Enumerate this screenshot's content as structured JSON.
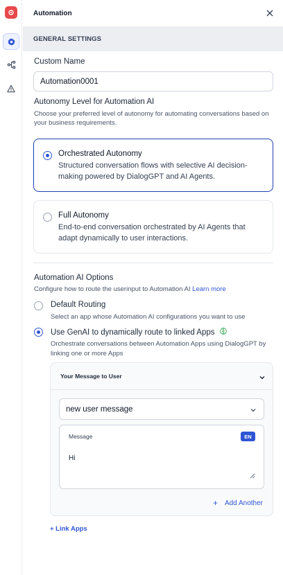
{
  "header": {
    "title": "Automation"
  },
  "section": {
    "title": "GENERAL SETTINGS"
  },
  "custom_name": {
    "label": "Custom Name",
    "value": "Automation0001"
  },
  "autonomy": {
    "label": "Autonomy Level for Automation AI",
    "description": "Choose your preferred level of autonomy for automating conversations based on your business requirements.",
    "options": [
      {
        "title": "Orchestrated Autonomy",
        "description": "Structured conversation flows with selective AI decision-making powered by DialogGPT and AI Agents.",
        "selected": true
      },
      {
        "title": "Full Autonomy",
        "description": "End-to-end conversation orchestrated by AI Agents that adapt dynamically to user interactions.",
        "selected": false
      }
    ]
  },
  "ai_options": {
    "label": "Automation AI Options",
    "description": "Configure how to route the userinput to Automation AI",
    "learn_more": "Learn more",
    "default_routing": {
      "title": "Default Routing",
      "description": "Select an app whose Automation AI configurations you want to use",
      "selected": false
    },
    "genai_routing": {
      "title": "Use GenAI to dynamically route to linked Apps",
      "description": "Orchestrate conversations between Automation Apps using DialogGPT by linking one or more Apps",
      "selected": true
    }
  },
  "message_panel": {
    "title": "Your Message to User",
    "select_value": "new user message",
    "message_label": "Message",
    "language": "EN",
    "message_text": "Hi",
    "add_another": "Add Another",
    "add_icon_glyph": "+"
  },
  "link_apps": "+ Link Apps",
  "colors": {
    "accent": "#2f55d4",
    "selected_border": "#1e40af",
    "logo": "#e8494a",
    "section_bg": "#eceef2"
  },
  "icons": [
    "logo-icon",
    "gear-icon",
    "flow-icon",
    "warning-icon",
    "close-icon",
    "chevron-down-icon",
    "brain-icon",
    "resize-handle-icon"
  ]
}
